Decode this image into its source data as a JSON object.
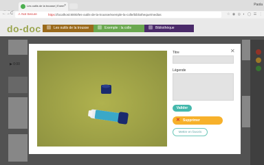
{
  "browser": {
    "tab_title": "Les outils de la trousse | Exem",
    "tab_close": "×",
    "user_name": "Paola",
    "security_label": "Not Secure",
    "url_scheme": "https",
    "url_rest": "://localhost:8000/les-outils-de-la-trousse/exemple-la-colle/bibliotheque/medias",
    "nav_back": "←",
    "nav_forward": "→",
    "nav_reload": "C"
  },
  "app": {
    "logo": "do-doc",
    "nav": [
      "Les outils de la trousse",
      "Exemple : la colle",
      "Bibliothèque"
    ]
  },
  "background": {
    "player_label": "▶ 0:00"
  },
  "modal": {
    "close": "✕",
    "title_label": "Titre",
    "caption_label": "Légende",
    "validate_label": "Valider",
    "delete_label": "Supprimer",
    "delete_icon": "✕",
    "favorite_label": "Mettre en favoris",
    "accent_color": "#45b8ac",
    "delete_color": "#f7b12b"
  }
}
